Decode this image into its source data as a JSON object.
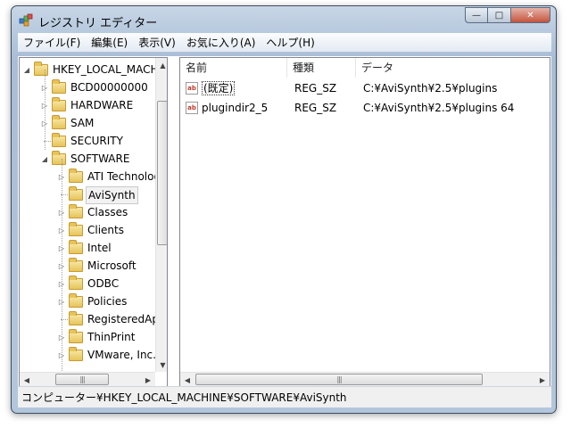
{
  "window": {
    "title": "レジストリ エディター",
    "minimize_glyph": "—",
    "maximize_glyph": "□",
    "close_glyph": "✕"
  },
  "menu": [
    "ファイル(F)",
    "編集(E)",
    "表示(V)",
    "お気に入り(A)",
    "ヘルプ(H)"
  ],
  "tree": {
    "items": [
      {
        "label": "HKEY_LOCAL_MACH",
        "expander": "expanded"
      },
      {
        "label": "BCD00000000",
        "expander": "collapsed"
      },
      {
        "label": "HARDWARE",
        "expander": "collapsed"
      },
      {
        "label": "SAM",
        "expander": "collapsed"
      },
      {
        "label": "SECURITY",
        "expander": "none"
      },
      {
        "label": "SOFTWARE",
        "expander": "expanded"
      },
      {
        "label": "ATI Technolog",
        "expander": "collapsed"
      },
      {
        "label": "AviSynth",
        "expander": "none",
        "selected": true
      },
      {
        "label": "Classes",
        "expander": "collapsed"
      },
      {
        "label": "Clients",
        "expander": "collapsed"
      },
      {
        "label": "Intel",
        "expander": "collapsed"
      },
      {
        "label": "Microsoft",
        "expander": "collapsed"
      },
      {
        "label": "ODBC",
        "expander": "collapsed"
      },
      {
        "label": "Policies",
        "expander": "collapsed"
      },
      {
        "label": "RegisteredAp",
        "expander": "none"
      },
      {
        "label": "ThinPrint",
        "expander": "collapsed"
      },
      {
        "label": "VMware, Inc.",
        "expander": "collapsed"
      }
    ]
  },
  "list": {
    "columns": [
      "名前",
      "種類",
      "データ"
    ],
    "rows": [
      {
        "name": "(既定)",
        "type": "REG_SZ",
        "data": "C:¥AviSynth¥2.5¥plugins",
        "icon": "ab"
      },
      {
        "name": "plugindir2_5",
        "type": "REG_SZ",
        "data": "C:¥AviSynth¥2.5¥plugins 64",
        "icon": "ab"
      }
    ]
  },
  "status": {
    "path": "コンピューター¥HKEY_LOCAL_MACHINE¥SOFTWARE¥AviSynth"
  }
}
